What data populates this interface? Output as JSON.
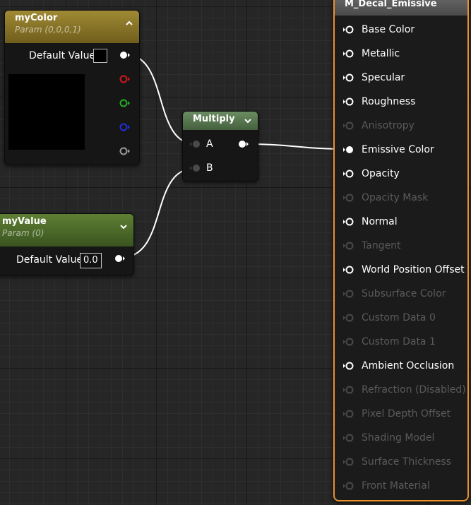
{
  "colors": {
    "color_node_header": "#8a7628",
    "value_node_header": "#4f6b2c",
    "multiply_header": "#5a7a52",
    "output_border": "#e8912d",
    "wire": "#ffffff"
  },
  "mycolor_node": {
    "title": "myColor",
    "subtitle": "Param (0,0,0,1)",
    "default_label": "Default Value",
    "preview_color": "#000000",
    "pins": [
      "white-output",
      "red-output",
      "green-output",
      "blue-output",
      "alpha-output"
    ]
  },
  "myvalue_node": {
    "title": "myValue",
    "subtitle": "Param (0)",
    "default_label": "Default Value",
    "value": "0.0"
  },
  "multiply_node": {
    "title": "Multiply",
    "input_a": "A",
    "input_b": "B"
  },
  "output_node": {
    "title": "M_Decal_Emissive",
    "pins": [
      {
        "label": "Base Color",
        "enabled": true
      },
      {
        "label": "Metallic",
        "enabled": true
      },
      {
        "label": "Specular",
        "enabled": true
      },
      {
        "label": "Roughness",
        "enabled": true
      },
      {
        "label": "Anisotropy",
        "enabled": false
      },
      {
        "label": "Emissive Color",
        "enabled": true
      },
      {
        "label": "Opacity",
        "enabled": true
      },
      {
        "label": "Opacity Mask",
        "enabled": false
      },
      {
        "label": "Normal",
        "enabled": true
      },
      {
        "label": "Tangent",
        "enabled": false
      },
      {
        "label": "World Position Offset",
        "enabled": true
      },
      {
        "label": "Subsurface Color",
        "enabled": false
      },
      {
        "label": "Custom Data 0",
        "enabled": false
      },
      {
        "label": "Custom Data 1",
        "enabled": false
      },
      {
        "label": "Ambient Occlusion",
        "enabled": true
      },
      {
        "label": "Refraction (Disabled)",
        "enabled": false
      },
      {
        "label": "Pixel Depth Offset",
        "enabled": false
      },
      {
        "label": "Shading Model",
        "enabled": false
      },
      {
        "label": "Surface Thickness",
        "enabled": false
      },
      {
        "label": "Front Material",
        "enabled": false
      }
    ]
  }
}
